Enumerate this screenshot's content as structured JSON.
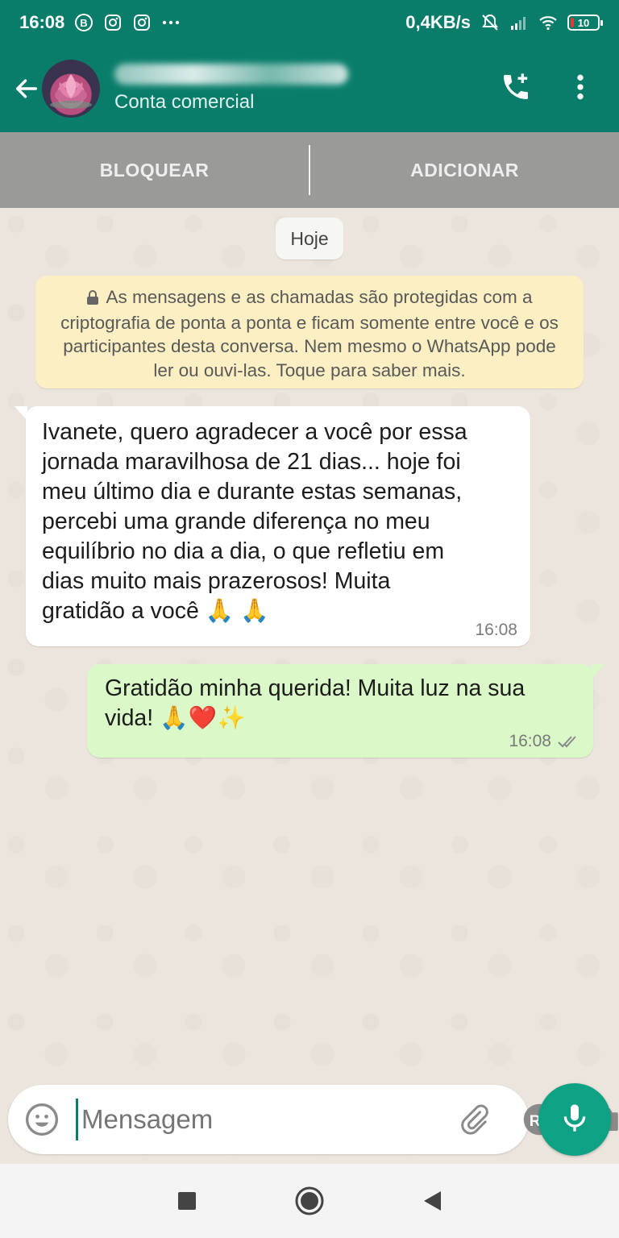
{
  "status_bar": {
    "time": "16:08",
    "net_speed": "0,4KB/s",
    "battery": "10",
    "icons": [
      "b-badge-icon",
      "instagram-icon",
      "instagram-icon",
      "more-dots-icon",
      "mute-icon",
      "signal-icon",
      "wifi-icon",
      "battery-icon"
    ]
  },
  "header": {
    "contact_subtitle": "Conta comercial",
    "icons": [
      "back-arrow-icon",
      "avatar-lotus",
      "add-call-icon",
      "overflow-menu-icon"
    ]
  },
  "action_bar": {
    "block_label": "BLOQUEAR",
    "add_label": "ADICIONAR"
  },
  "chat": {
    "date_label": "Hoje",
    "encryption_notice": "As mensagens e as chamadas são protegidas com a criptografia de ponta a ponta e ficam somente entre você e os participantes desta conversa. Nem mesmo o WhatsApp pode ler ou ouvi-las. Toque para saber mais.",
    "messages": [
      {
        "direction": "incoming",
        "text": "Ivanete, quero agradecer a você por essa\njornada maravilhosa de 21 dias... hoje foi\nmeu último dia e durante estas semanas,\npercebi uma grande diferença no meu\nequilíbrio no dia a dia, o que refletiu em\ndias muito mais prazerosos! Muita\ngratidão a você 🙏 🙏",
        "time": "16:08"
      },
      {
        "direction": "outgoing",
        "text": "Gratidão minha querida! Muita luz na sua\nvida! 🙏❤️✨",
        "time": "16:08",
        "status": "delivered"
      }
    ]
  },
  "composer": {
    "placeholder": "Mensagem",
    "icons": [
      "emoji-icon",
      "attach-icon",
      "payment-icon",
      "camera-icon",
      "mic-icon"
    ]
  },
  "colors": {
    "header": "#0a7d6a",
    "outgoing_bubble": "#dbf8c8",
    "incoming_bubble": "#ffffff",
    "notice": "#fcefc4",
    "mic_button": "#0fa184"
  }
}
